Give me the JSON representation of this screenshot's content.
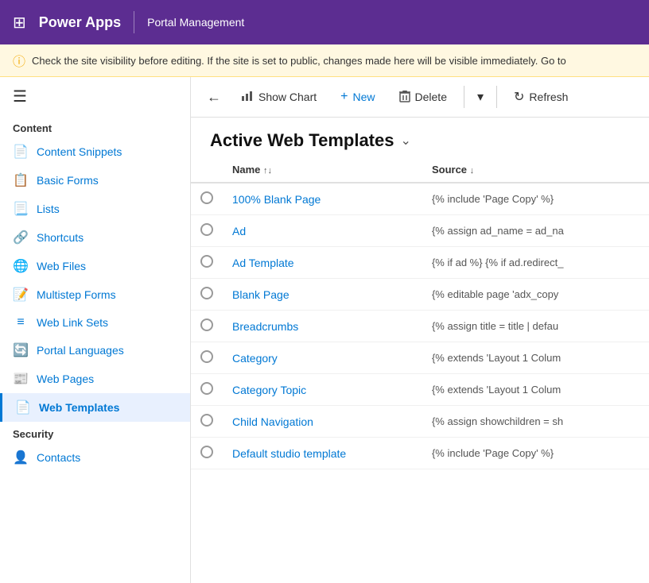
{
  "topbar": {
    "app_name": "Power Apps",
    "module_name": "Portal Management",
    "waffle_icon": "⊞"
  },
  "warning": {
    "icon": "ⓘ",
    "text": "Check the site visibility before editing. If the site is set to public, changes made here will be visible immediately. Go to"
  },
  "toolbar": {
    "back_icon": "←",
    "show_chart_label": "Show Chart",
    "show_chart_icon": "📊",
    "new_label": "New",
    "new_icon": "+",
    "delete_label": "Delete",
    "delete_icon": "🗑",
    "more_icon": "▾",
    "refresh_label": "Refresh",
    "refresh_icon": "↻"
  },
  "page": {
    "title": "Active Web Templates",
    "title_chevron": "⌄"
  },
  "table": {
    "columns": [
      {
        "id": "name",
        "label": "Name",
        "sort": "↑↓"
      },
      {
        "id": "source",
        "label": "Source",
        "sort": "↓"
      }
    ],
    "rows": [
      {
        "name": "100% Blank Page",
        "source": "{% include 'Page Copy' %}"
      },
      {
        "name": "Ad",
        "source": "{% assign ad_name = ad_na"
      },
      {
        "name": "Ad Template",
        "source": "{% if ad %} {% if ad.redirect_"
      },
      {
        "name": "Blank Page",
        "source": "{% editable page 'adx_copy"
      },
      {
        "name": "Breadcrumbs",
        "source": "{% assign title = title | defau"
      },
      {
        "name": "Category",
        "source": "{% extends 'Layout 1 Colum"
      },
      {
        "name": "Category Topic",
        "source": "{% extends 'Layout 1 Colum"
      },
      {
        "name": "Child Navigation",
        "source": "{% assign showchildren = sh"
      },
      {
        "name": "Default studio template",
        "source": "{% include 'Page Copy' %}"
      }
    ]
  },
  "sidebar": {
    "hamburger": "☰",
    "sections": [
      {
        "title": "Content",
        "items": [
          {
            "id": "content-snippets",
            "label": "Content Snippets",
            "icon": "📄"
          },
          {
            "id": "basic-forms",
            "label": "Basic Forms",
            "icon": "📋"
          },
          {
            "id": "lists",
            "label": "Lists",
            "icon": "📃"
          },
          {
            "id": "shortcuts",
            "label": "Shortcuts",
            "icon": "🔗"
          },
          {
            "id": "web-files",
            "label": "Web Files",
            "icon": "🌐"
          },
          {
            "id": "multistep-forms",
            "label": "Multistep Forms",
            "icon": "📝"
          },
          {
            "id": "web-link-sets",
            "label": "Web Link Sets",
            "icon": "≡"
          },
          {
            "id": "portal-languages",
            "label": "Portal Languages",
            "icon": "🔄"
          },
          {
            "id": "web-pages",
            "label": "Web Pages",
            "icon": "📰"
          },
          {
            "id": "web-templates",
            "label": "Web Templates",
            "icon": "📄",
            "active": true
          }
        ]
      },
      {
        "title": "Security",
        "items": [
          {
            "id": "contacts",
            "label": "Contacts",
            "icon": "👤"
          }
        ]
      }
    ]
  },
  "colors": {
    "topbar_bg": "#5c2d91",
    "link_color": "#0078d4",
    "active_border": "#0078d4"
  }
}
